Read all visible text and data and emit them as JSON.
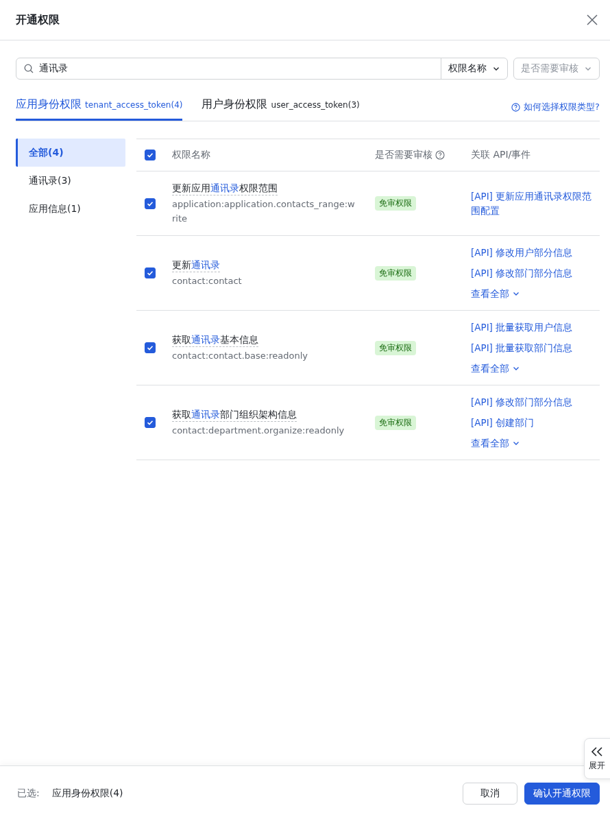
{
  "dialog": {
    "title": "开通权限"
  },
  "search": {
    "value": "通讯录",
    "filters": [
      "权限名称",
      "是否需要审核"
    ]
  },
  "tabs": [
    {
      "label": "应用身份权限",
      "token": "tenant_access_token(4)",
      "selected": true
    },
    {
      "label": "用户身份权限",
      "token": "user_access_token(3)",
      "selected": false
    }
  ],
  "help_link": "如何选择权限类型?",
  "sidebar": {
    "items": [
      {
        "label": "全部(4)",
        "selected": true
      },
      {
        "label": "通讯录(3)",
        "selected": false
      },
      {
        "label": "应用信息(1)",
        "selected": false
      }
    ]
  },
  "table": {
    "select_all": true,
    "columns": [
      "权限名称",
      "是否需要审核",
      "关联 API/事件"
    ],
    "rows": [
      {
        "checked": true,
        "name_parts": [
          {
            "text": "更新应用",
            "highlight": false
          },
          {
            "text": "通讯录",
            "highlight": true
          },
          {
            "text": "权限范围",
            "highlight": false
          }
        ],
        "scope": "application:application.contacts_range:write",
        "review": "免审权限",
        "apis": [
          "[API] 更新应用通讯录权限范围配置"
        ]
      },
      {
        "checked": true,
        "name_parts": [
          {
            "text": "更新",
            "highlight": false
          },
          {
            "text": "通讯录",
            "highlight": true
          }
        ],
        "scope": "contact:contact",
        "review": "免审权限",
        "apis": [
          "[API] 修改用户部分信息",
          "[API] 修改部门部分信息"
        ],
        "view_all": "查看全部"
      },
      {
        "checked": true,
        "name_parts": [
          {
            "text": "获取",
            "highlight": false
          },
          {
            "text": "通讯录",
            "highlight": true
          },
          {
            "text": "基本信息",
            "highlight": false
          }
        ],
        "scope": "contact:contact.base:readonly",
        "review": "免审权限",
        "apis": [
          "[API] 批量获取用户信息",
          "[API] 批量获取部门信息"
        ],
        "view_all": "查看全部"
      },
      {
        "checked": true,
        "name_parts": [
          {
            "text": "获取",
            "highlight": false
          },
          {
            "text": "通讯录",
            "highlight": true
          },
          {
            "text": "部门组织架构信息",
            "highlight": false
          }
        ],
        "scope": "contact:department.organize:readonly",
        "review": "免审权限",
        "apis": [
          "[API] 修改部门部分信息",
          "[API] 创建部门"
        ],
        "view_all": "查看全部"
      }
    ]
  },
  "expand_tab": {
    "label": "展开"
  },
  "footer": {
    "selected_label": "已选:",
    "selected_value": "应用身份权限(4)",
    "buttons": [
      {
        "label": "取消",
        "kind": "secondary"
      },
      {
        "label": "确认开通权限",
        "kind": "primary"
      }
    ]
  }
}
